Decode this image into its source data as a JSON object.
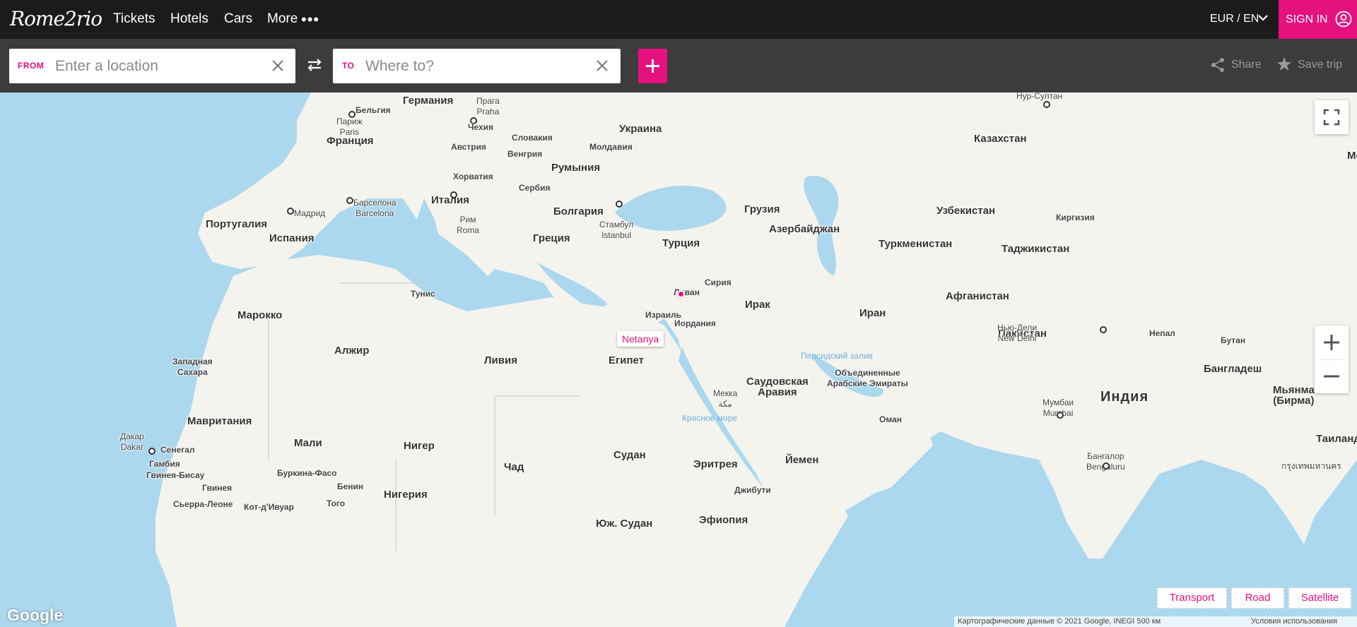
{
  "brand": {
    "logo_text": "Rome2rio"
  },
  "nav": {
    "tickets": "Tickets",
    "hotels": "Hotels",
    "cars": "Cars",
    "more": "More",
    "more_dots": "•••",
    "language": "EUR / EN",
    "sign_in": "SIGN IN"
  },
  "search": {
    "from_tag": "FROM",
    "from_placeholder": "Enter a location",
    "to_tag": "TO",
    "to_placeholder": "Where to?",
    "share": "Share",
    "save_trip": "Save trip"
  },
  "map": {
    "marker_label": "Netanya",
    "countries": {
      "germany": "Германия",
      "belgium": "Бельгия",
      "czech": "Чехия",
      "slovakia": "Словакия",
      "ukraine": "Украина",
      "austria": "Австрия",
      "hungary": "Венгрия",
      "moldova": "Молдавия",
      "france": "Франция",
      "romania": "Румыния",
      "croatia": "Хорватия",
      "serbia": "Сербия",
      "italy": "Италия",
      "bulgaria": "Болгария",
      "portugal": "Португалия",
      "spain": "Испания",
      "greece": "Греция",
      "turkey": "Турция",
      "georgia": "Грузия",
      "azerbaijan": "Азербайджан",
      "kazakhstan": "Казахстан",
      "uzbekistan": "Узбекистан",
      "kyrgyzstan": "Киргизия",
      "turkmenistan": "Туркменистан",
      "tajikistan": "Таджикистан",
      "syria": "Сирия",
      "lebanon": "Ливан",
      "iraq": "Ирак",
      "iran": "Иран",
      "afghanistan": "Афганистан",
      "pakistan": "Пакистан",
      "israel": "Израиль",
      "jordan": "Иордания",
      "tunisia": "Тунис",
      "morocco": "Марокко",
      "algeria": "Алжир",
      "libya": "Ливия",
      "egypt": "Египет",
      "western_sahara": "Западная\nСахара",
      "mauritania": "Мавритания",
      "mali": "Мали",
      "niger": "Нигер",
      "chad": "Чад",
      "sudan": "Судан",
      "eritrea": "Эритрея",
      "yemen": "Йемен",
      "saudi": "Саудовская\nАравия",
      "uae": "Объединенные\nАрабские Эмираты",
      "oman": "Оман",
      "india": "Индия",
      "nepal": "Непал",
      "bhutan": "Бутан",
      "bangladesh": "Бангладеш",
      "myanmar": "Мьянма\n(Бирма)",
      "senegal": "Сенегал",
      "gambia": "Гамбия",
      "guinea_bissau": "Гвинея-Бисау",
      "guinea": "Гвинея",
      "burkina": "Буркина-Фасо",
      "benin": "Бенин",
      "togo": "Того",
      "nigeria": "Нигерия",
      "sierra_leone": "Сьерра-Леоне",
      "ivory_coast": "Кот-д'Ивуар",
      "djibouti": "Джибути",
      "ethiopia": "Эфиопия",
      "south_sudan": "Юж. Судан",
      "thailand": "Таиланд",
      "mongolia": "Мон"
    },
    "cities": {
      "prague": "Прага\nPraha",
      "paris": "Париж\nParis",
      "madrid": "Мадрид",
      "barcelona": "Барселона\nBarcelona",
      "rome": "Рим\nRoma",
      "istanbul": "Стамбул\nIstanbul",
      "nursultan": "Нур-Султан",
      "newdelhi": "Нью-Дели\nNew Delhi",
      "mumbai": "Мумбаи\nMumbai",
      "mecca": "Мекка\nمكة",
      "dakar": "Дакар\nDakar",
      "bangalore": "Бангалор\nBengaluru",
      "bangkok": "กรุงเทพมหานคร"
    },
    "seas": {
      "persian_gulf": "Персидский залив",
      "red_sea": "Красное море"
    },
    "layers": {
      "transport": "Transport",
      "road": "Road",
      "satellite": "Satellite"
    },
    "attribution": "Картографические данные © 2021 Google, INEGI   500 км",
    "terms": "Условия использования",
    "google": "Google",
    "colors": {
      "accent": "#e5117f",
      "land": "#f5f3ee",
      "water": "#abd8ee"
    }
  }
}
